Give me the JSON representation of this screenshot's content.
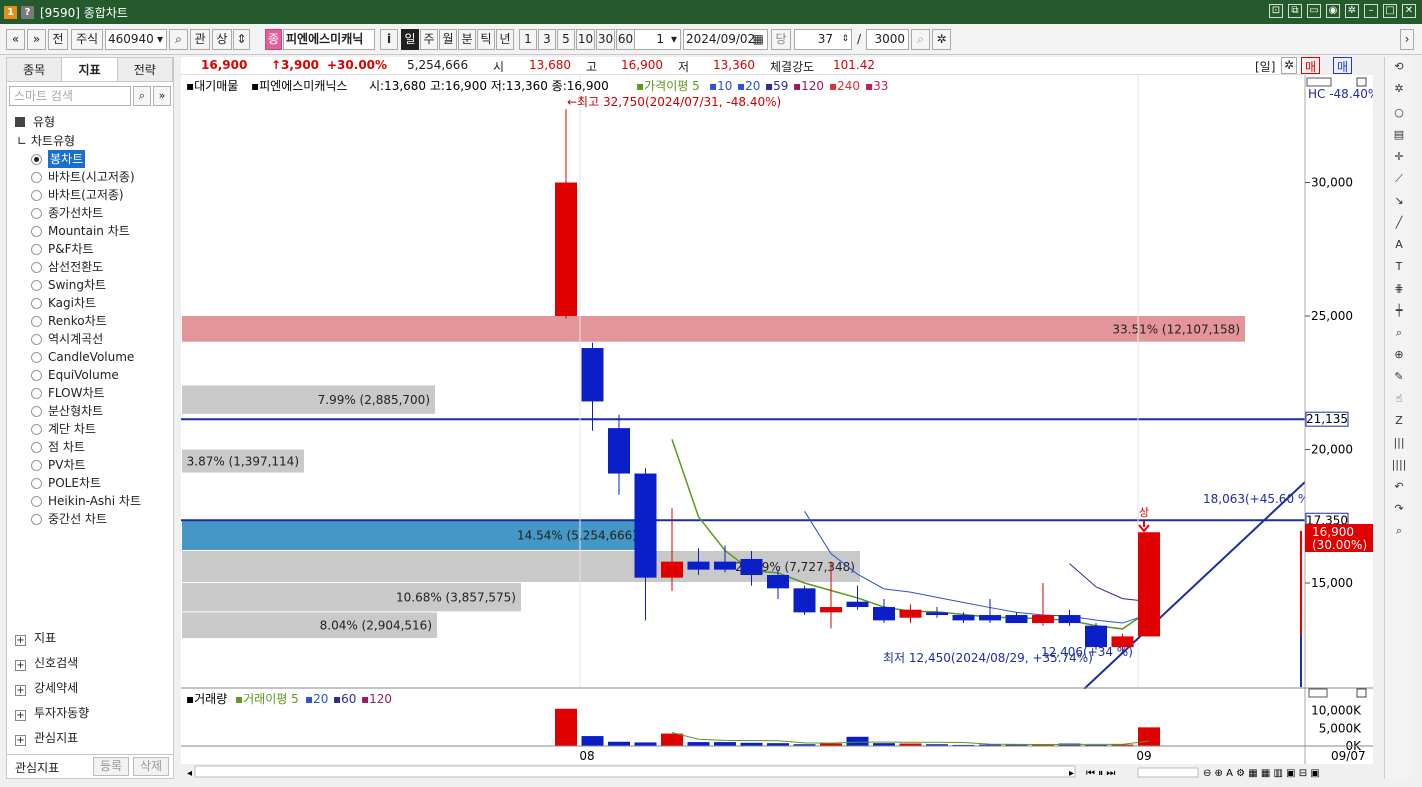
{
  "window": {
    "code": "[9590]",
    "title": "종합차트"
  },
  "toolbar": {
    "nav_prev": "«",
    "nav_dropdown": "»",
    "jeon": "전",
    "market": "주식",
    "code": "460940",
    "gwan": "관",
    "sang": "상",
    "jong": "종",
    "stock_name": "피엔에스미캐닉",
    "info": "i",
    "periods": [
      "일",
      "주",
      "월",
      "분",
      "틱",
      "년"
    ],
    "periods_selected": "일",
    "numbers": [
      "1",
      "3",
      "5",
      "10",
      "30",
      "60"
    ],
    "interval": "1",
    "date": "2024/09/02",
    "dang": "당",
    "count": "37",
    "sep": "/",
    "total": "3000"
  },
  "left_panel": {
    "tabs": [
      "종목",
      "지표",
      "전략"
    ],
    "active_tab": "지표",
    "search_placeholder": "스마트 검색",
    "section": "유형",
    "subsection": "차트유형",
    "chart_types": [
      "봉차트",
      "바차트(시고저종)",
      "바차트(고저종)",
      "종가선차트",
      "Mountain 차트",
      "P&F차트",
      "삼선전환도",
      "Swing차트",
      "Kagi차트",
      "Renko차트",
      "역시계곡선",
      "CandleVolume",
      "EquiVolume",
      "FLOW차트",
      "분산형차트",
      "계단 차트",
      "점 차트",
      "PV차트",
      "POLE차트",
      "Heikin-Ashi 차트",
      "중간선 차트"
    ],
    "selected_type": "봉차트",
    "bottom_items": [
      "지표",
      "신호검색",
      "강세약세",
      "투자자동향",
      "관심지표"
    ],
    "watch_label": "관심지표",
    "register": "등록",
    "delete": "삭제"
  },
  "quote": {
    "price": "16,900",
    "change": "↑3,900",
    "pct": "+30.00%",
    "volume": "5,254,666",
    "open_label": "시",
    "open": "13,680",
    "high_label": "고",
    "high": "16,900",
    "low_label": "저",
    "low": "13,360",
    "strength_label": "체결강도",
    "strength": "101.42",
    "period_tag": "[일]",
    "buy": "매수",
    "sell": "매도"
  },
  "chart": {
    "legend_prefix": "대기매물",
    "legend_name": "피엔에스미캐닉스",
    "legend_ohlc": "시:13,680 고:16,900 저:13,360 종:16,900",
    "ma_label": "가격이평",
    "ma_periods": [
      "5",
      "10",
      "20",
      "59",
      "120",
      "240",
      "33"
    ],
    "ma_colors": [
      "#5a9a1a",
      "#2a52d8",
      "#2a52d8",
      "#2a2aa0",
      "#9a1a5a",
      "#e03030",
      "#c02050"
    ],
    "high_annot": "←최고 32,750(2024/07/31, -48.40%)",
    "low_annot": "최저 12,450(2024/08/29, +35.74%)",
    "low_annot2": "12,406(+34 %)",
    "hc_label": "HC -48.40%",
    "trend_annot": "18,063(+45.60 %)",
    "up_marker": "상",
    "y_ticks": [
      "30,000",
      "25,000",
      "20,000",
      "15,000"
    ],
    "y_values": [
      30000,
      25000,
      20000,
      15000
    ],
    "hline_labels": [
      "21,135",
      "17,350"
    ],
    "hline_values": [
      21135,
      17350
    ],
    "price_box": [
      "16,900",
      "(30.00%)"
    ],
    "x_labels": [
      "08",
      "09",
      "09/07"
    ],
    "vol_label": "거래량",
    "vol_ma_label": "거래이평",
    "vol_ma_periods": [
      "5",
      "20",
      "60",
      "120"
    ],
    "vol_ticks": [
      "10,000K",
      "5,000K",
      "0K"
    ],
    "vp_labels": [
      "33.51% (12,107,158)",
      "7.99% (2,885,700)",
      "3.87% (1,397,114)",
      "14.54% (5,254,666)",
      "21.39% (7,727,348)",
      "10.68% (3,857,575)",
      "8.04% (2,904,516)"
    ],
    "vp_values": [
      33.51,
      7.99,
      3.87,
      14.54,
      21.39,
      10.68,
      8.04
    ]
  },
  "chart_data": {
    "type": "candlestick",
    "title": "피엔에스미캐닉스",
    "ylim": [
      11000,
      33500
    ],
    "candles": [
      {
        "o": 25000,
        "h": 32750,
        "l": 24900,
        "c": 30000
      },
      {
        "o": 23800,
        "h": 24000,
        "l": 20700,
        "c": 21800
      },
      {
        "o": 20800,
        "h": 21300,
        "l": 18300,
        "c": 19100
      },
      {
        "o": 19100,
        "h": 19300,
        "l": 13600,
        "c": 15200
      },
      {
        "o": 15200,
        "h": 17800,
        "l": 14700,
        "c": 15800
      },
      {
        "o": 15800,
        "h": 16300,
        "l": 15300,
        "c": 15500
      },
      {
        "o": 15800,
        "h": 16400,
        "l": 15400,
        "c": 15500
      },
      {
        "o": 15900,
        "h": 16200,
        "l": 14900,
        "c": 15300
      },
      {
        "o": 15300,
        "h": 15500,
        "l": 14400,
        "c": 14800
      },
      {
        "o": 14800,
        "h": 14900,
        "l": 13800,
        "c": 13900
      },
      {
        "o": 13900,
        "h": 15800,
        "l": 13300,
        "c": 14100
      },
      {
        "o": 14300,
        "h": 14900,
        "l": 14000,
        "c": 14100
      },
      {
        "o": 14100,
        "h": 14400,
        "l": 13500,
        "c": 13600
      },
      {
        "o": 13700,
        "h": 14200,
        "l": 13500,
        "c": 14000
      },
      {
        "o": 13900,
        "h": 14100,
        "l": 13700,
        "c": 13800
      },
      {
        "o": 13800,
        "h": 13900,
        "l": 13500,
        "c": 13600
      },
      {
        "o": 13800,
        "h": 14400,
        "l": 13500,
        "c": 13600
      },
      {
        "o": 13800,
        "h": 13900,
        "l": 13500,
        "c": 13500
      },
      {
        "o": 13500,
        "h": 15000,
        "l": 13400,
        "c": 13800
      },
      {
        "o": 13800,
        "h": 14000,
        "l": 13400,
        "c": 13500
      },
      {
        "o": 13400,
        "h": 13500,
        "l": 12500,
        "c": 12600
      },
      {
        "o": 12600,
        "h": 13100,
        "l": 12450,
        "c": 13000
      },
      {
        "o": 13000,
        "h": 16900,
        "l": 13360,
        "c": 16900
      }
    ],
    "volumes": [
      10500,
      2800,
      1200,
      1000,
      3500,
      1100,
      1100,
      900,
      800,
      500,
      700,
      2600,
      800,
      700,
      500,
      300,
      400,
      400,
      500,
      700,
      300,
      400,
      5254
    ]
  }
}
